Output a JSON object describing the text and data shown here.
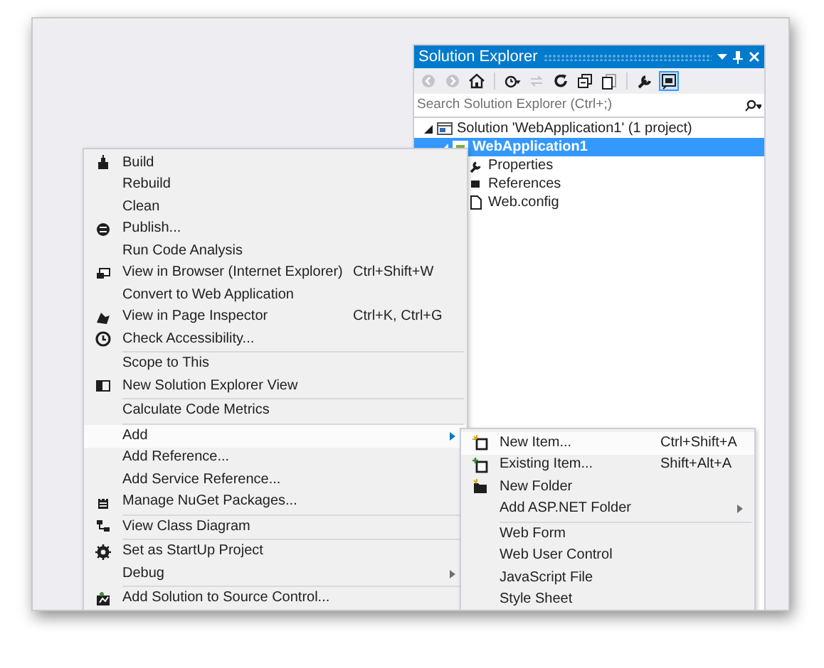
{
  "solution_explorer": {
    "title": "Solution Explorer",
    "toolbar": [
      {
        "kind": "back",
        "selected": false
      },
      {
        "kind": "forward",
        "selected": false
      },
      {
        "kind": "home",
        "selected": false
      },
      {
        "kind": "history",
        "selected": false
      },
      {
        "kind": "sync",
        "selected": false
      },
      {
        "kind": "refresh",
        "selected": false
      },
      {
        "kind": "collapse",
        "selected": false
      },
      {
        "kind": "show-all",
        "selected": false
      },
      {
        "kind": "properties",
        "selected": false
      },
      {
        "kind": "preview",
        "selected": true
      }
    ],
    "search": {
      "placeholder": "Search Solution Explorer (Ctrl+;)"
    },
    "tree": [
      {
        "label": "Solution 'WebApplication1' (1 project)",
        "selected": false,
        "children": [
          {
            "label": "WebApplication1",
            "selected": true,
            "children": [
              {
                "label": "Properties",
                "selected": false
              },
              {
                "label": "References",
                "selected": false
              },
              {
                "label": "Web.config",
                "selected": false
              }
            ]
          }
        ]
      }
    ]
  },
  "context_menu": [
    {
      "kind": "item",
      "label": "Build",
      "selected": false
    },
    {
      "kind": "item",
      "label": "Rebuild",
      "selected": false
    },
    {
      "kind": "item",
      "label": "Clean",
      "selected": false
    },
    {
      "kind": "item",
      "label": "Publish...",
      "selected": false
    },
    {
      "kind": "item",
      "label": "Run Code Analysis",
      "selected": false
    },
    {
      "kind": "item",
      "label": "View in Browser (Internet Explorer)",
      "shortcut": "Ctrl+Shift+W",
      "selected": false
    },
    {
      "kind": "item",
      "label": "Convert to Web Application",
      "selected": false
    },
    {
      "kind": "item",
      "label": "View in Page Inspector",
      "shortcut": "Ctrl+K, Ctrl+G",
      "selected": false
    },
    {
      "kind": "item",
      "label": "Check Accessibility...",
      "selected": false
    },
    {
      "kind": "separator"
    },
    {
      "kind": "item",
      "label": "Scope to This",
      "selected": false
    },
    {
      "kind": "item",
      "label": "New Solution Explorer View",
      "selected": false
    },
    {
      "kind": "separator"
    },
    {
      "kind": "item",
      "label": "Calculate Code Metrics",
      "selected": false
    },
    {
      "kind": "separator"
    },
    {
      "kind": "item",
      "label": "Add",
      "submenu": true,
      "selected": true
    },
    {
      "kind": "item",
      "label": "Add Reference...",
      "selected": false
    },
    {
      "kind": "item",
      "label": "Add Service Reference...",
      "selected": false
    },
    {
      "kind": "item",
      "label": "Manage NuGet Packages...",
      "selected": false
    },
    {
      "kind": "separator"
    },
    {
      "kind": "item",
      "label": "View Class Diagram",
      "selected": false
    },
    {
      "kind": "separator"
    },
    {
      "kind": "item",
      "label": "Set as StartUp Project",
      "selected": false
    },
    {
      "kind": "item",
      "label": "Debug",
      "submenu": true,
      "selected": false
    },
    {
      "kind": "separator"
    },
    {
      "kind": "item",
      "label": "Add Solution to Source Control...",
      "selected": false
    }
  ],
  "add_submenu": [
    {
      "kind": "item",
      "label": "New Item...",
      "shortcut": "Ctrl+Shift+A",
      "selected": true
    },
    {
      "kind": "item",
      "label": "Existing Item...",
      "shortcut": "Shift+Alt+A",
      "selected": false
    },
    {
      "kind": "item",
      "label": "New Folder",
      "selected": false
    },
    {
      "kind": "item",
      "label": "Add ASP.NET Folder",
      "submenu": true,
      "selected": false
    },
    {
      "kind": "separator"
    },
    {
      "kind": "item",
      "label": "Web Form",
      "selected": false
    },
    {
      "kind": "item",
      "label": "Web User Control",
      "selected": false
    },
    {
      "kind": "item",
      "label": "JavaScript File",
      "selected": false
    },
    {
      "kind": "item",
      "label": "Style Sheet",
      "selected": false
    }
  ]
}
